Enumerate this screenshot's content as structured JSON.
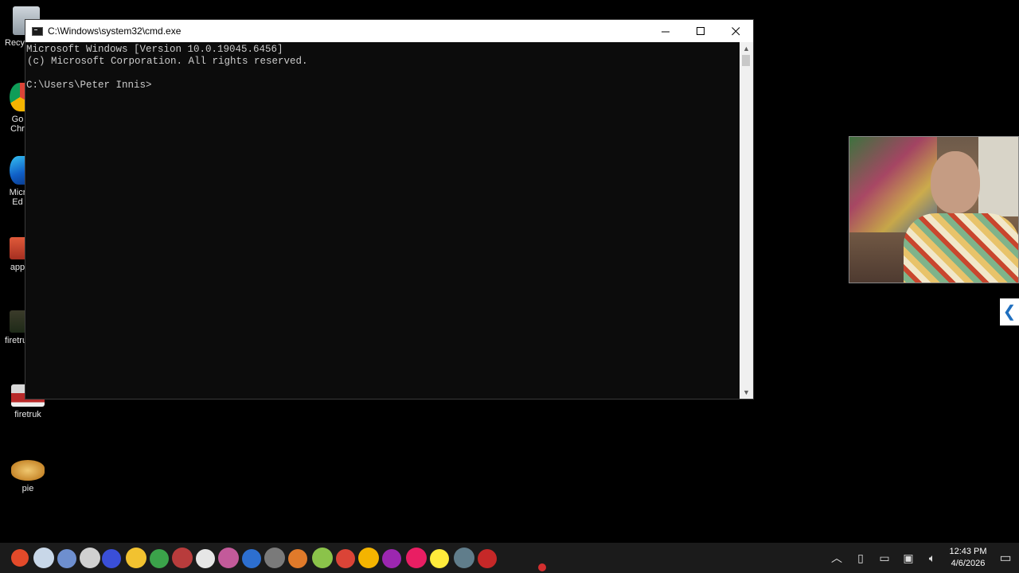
{
  "desktop": {
    "icons": [
      {
        "label": "Recy",
        "icon": "recycle-bin-icon"
      },
      {
        "label": "Go\nChr",
        "icon": "chrome-icon"
      },
      {
        "label": "Micr\nEd",
        "icon": "edge-icon"
      },
      {
        "label": "app",
        "icon": "app-icon"
      },
      {
        "label": "firetru",
        "icon": "firetruck-icon"
      },
      {
        "label": "firetruk",
        "icon": "firetruck-icon"
      },
      {
        "label": "pie",
        "icon": "pie-icon"
      }
    ]
  },
  "cmd": {
    "title": "C:\\Windows\\system32\\cmd.exe",
    "lines": [
      "Microsoft Windows [Version 10.0.19045.6456]",
      "(c) Microsoft Corporation. All rights reserved.",
      "",
      "C:\\Users\\Peter Innis>"
    ]
  },
  "taskbar": {
    "time": "12:43 PM",
    "date": "4/6/2026"
  },
  "colors": {
    "console_bg": "#0c0c0c",
    "console_text": "#cccccc",
    "titlebar": "#ffffff",
    "taskbar": "#1b1b1b"
  }
}
